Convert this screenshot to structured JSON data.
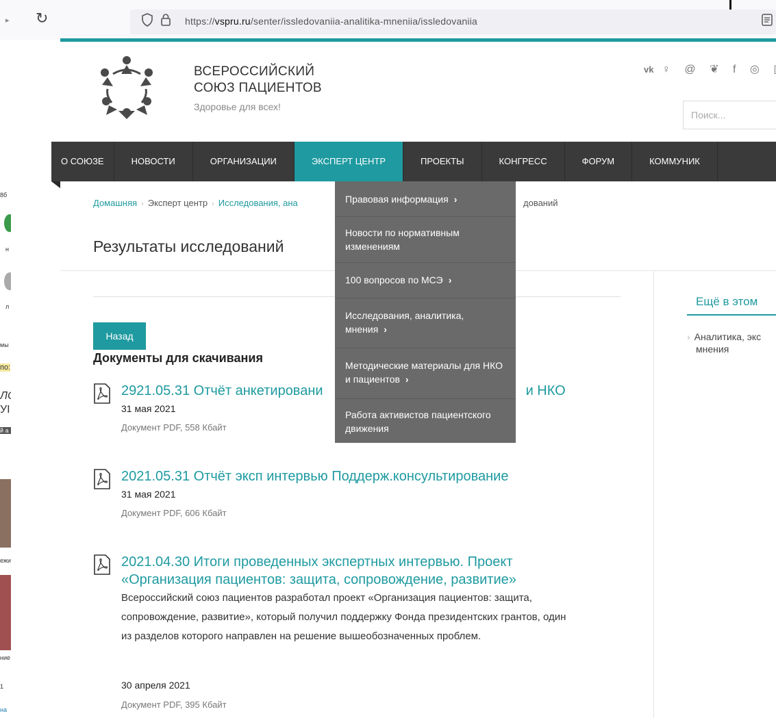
{
  "browser": {
    "url_prefix": "https://",
    "url_domain": "vspru.ru",
    "url_path": "/senter/issledovaniia-analitika-mneniia/issledovaniia"
  },
  "site": {
    "name_line1": "ВСЕРОССИЙСКИЙ",
    "name_line2": "СОЮЗ ПАЦИЕНТОВ",
    "tagline": "Здоровье для всех!",
    "social_icons": [
      "vk-icon",
      "odnoklassniki-icon",
      "mail-icon",
      "twitter-icon",
      "facebook-icon",
      "instagram-icon",
      "youtube-icon"
    ],
    "search_placeholder": "Поиск..."
  },
  "nav": {
    "items": [
      {
        "label": "О СОЮЗЕ"
      },
      {
        "label": "НОВОСТИ"
      },
      {
        "label": "ОРГАНИЗАЦИИ"
      },
      {
        "label": "ЭКСПЕРТ ЦЕНТР"
      },
      {
        "label": "ПРОЕКТЫ"
      },
      {
        "label": "КОНГРЕСС"
      },
      {
        "label": "ФОРУМ"
      },
      {
        "label": "КОММУНИК"
      }
    ]
  },
  "dropdown": {
    "items": [
      {
        "label": "Правовая информация",
        "arrow": "›"
      },
      {
        "label": "Новости по нормативным изменениям",
        "arrow": ""
      },
      {
        "label": "100 вопросов по МСЭ",
        "arrow": "›"
      },
      {
        "label": "Исследования, аналитика, мнения",
        "arrow": "›"
      },
      {
        "label": "Методические материалы для НКО и пациентов",
        "arrow": "›"
      },
      {
        "label": "Работа активистов пациентского движения",
        "arrow": ""
      }
    ]
  },
  "breadcrumb": {
    "home": "Домашняя",
    "expert": "Эксперт центр",
    "research": "Исследования, ана",
    "tail": "дований"
  },
  "page": {
    "title": "Результаты исследований",
    "back_label": "Назад",
    "section_title": "Документы для скачивания"
  },
  "documents": [
    {
      "title_a": "2921.05.31 Отчёт анкетировани",
      "title_b": "и НКО",
      "date": "31 мая 2021",
      "meta": "Документ PDF, 558 Кбайт"
    },
    {
      "title": "2021.05.31 Отчёт эксп интервью Поддерж.консультирование",
      "date": "31 мая 2021",
      "meta": "Документ PDF, 606 Кбайт"
    },
    {
      "title": "2021.04.30 Итоги проведенных экспертных интервью. Проект «Организация пациентов: защита, сопровождение, развитие»",
      "description": "Всероссийский союз пациентов разработал проект «Организация пациентов: защита, сопровождение, развитие», который получил поддержку Фонда президентских грантов, один из разделов которого направлен на решение вышеобозначенных проблем.",
      "date": "30 апреля 2021",
      "meta": "Документ PDF, 395 Кбайт"
    }
  ],
  "sidebar": {
    "title": "Ещё в этом",
    "item_line1": "Аналитика, экс",
    "item_line2": "мнения"
  },
  "left_strip": {
    "labels": [
      "8б",
      "н",
      "л",
      "мы",
      "по:",
      "ЛС",
      "УІ",
      "й а",
      "ежи",
      "ние",
      "1",
      "на"
    ]
  },
  "colors": {
    "teal": "#1e9aa0",
    "nav_bg": "#3a3a3a",
    "dropdown_bg": "#6a6a6a"
  }
}
